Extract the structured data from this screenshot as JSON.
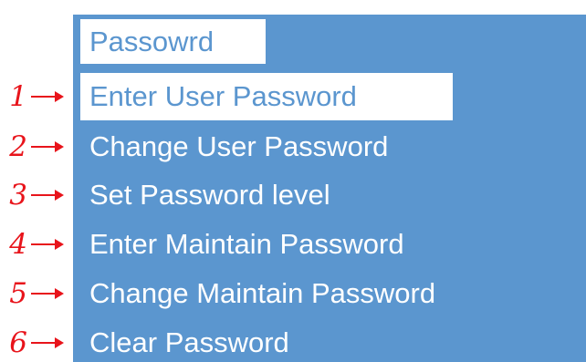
{
  "screen": {
    "title": "Passowrd",
    "colors": {
      "panel": "#5b96cf",
      "text": "#ffffff",
      "highlight": "#ffffff",
      "annotation": "#e8141b"
    }
  },
  "menu": {
    "selected_index": 0,
    "items": [
      {
        "number": "1",
        "label": "Enter User Password"
      },
      {
        "number": "2",
        "label": "Change User Password"
      },
      {
        "number": "3",
        "label": "Set Password level"
      },
      {
        "number": "4",
        "label": "Enter Maintain Password"
      },
      {
        "number": "5",
        "label": "Change Maintain Password"
      },
      {
        "number": "6",
        "label": "Clear Password"
      }
    ]
  }
}
